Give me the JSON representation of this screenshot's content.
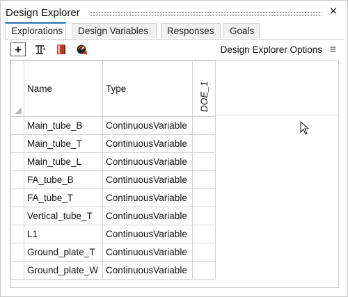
{
  "window": {
    "title": "Design Explorer",
    "close_glyph": "×"
  },
  "tabs": [
    {
      "label": "Explorations",
      "active": true
    },
    {
      "label": "Design Variables",
      "active": false
    },
    {
      "label": "Responses",
      "active": false
    },
    {
      "label": "Goals",
      "active": false
    }
  ],
  "toolbar": {
    "add_label": "+",
    "options_label": "Design Explorer Options",
    "menu_glyph": "≡",
    "icons": [
      "add-icon",
      "setup-icon",
      "book-icon",
      "run-icon"
    ]
  },
  "table": {
    "columns": [
      "Name",
      "Type",
      "DOE_1"
    ],
    "rows": [
      {
        "name": "Main_tube_B",
        "type": "ContinuousVariable"
      },
      {
        "name": "Main_tube_T",
        "type": "ContinuousVariable"
      },
      {
        "name": "Main_tube_L",
        "type": "ContinuousVariable"
      },
      {
        "name": "FA_tube_B",
        "type": "ContinuousVariable"
      },
      {
        "name": "FA_tube_T",
        "type": "ContinuousVariable"
      },
      {
        "name": "Vertical_tube_T",
        "type": "ContinuousVariable"
      },
      {
        "name": "L1",
        "type": "ContinuousVariable"
      },
      {
        "name": "Ground_plate_T",
        "type": "ContinuousVariable"
      },
      {
        "name": "Ground_plate_W",
        "type": "ContinuousVariable"
      }
    ]
  },
  "colors": {
    "active_tab_accent": "#2a6fb0",
    "border": "#cfcfcf"
  }
}
